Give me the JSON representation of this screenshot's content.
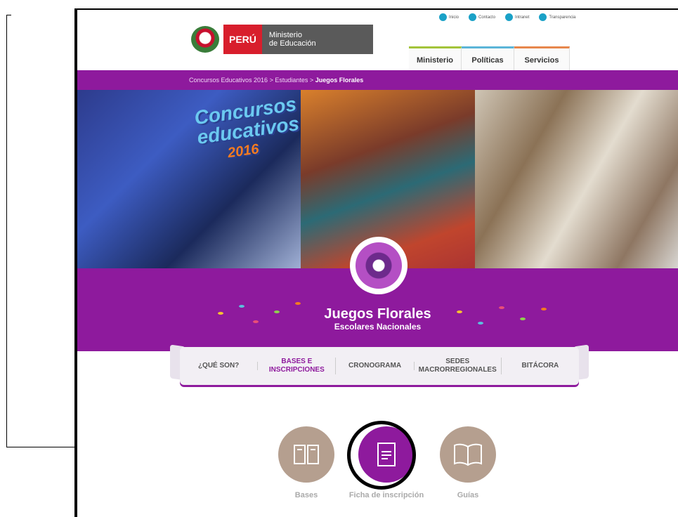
{
  "header": {
    "logo_country": "PERÚ",
    "logo_ministry_line1": "Ministerio",
    "logo_ministry_line2": "de Educación",
    "top_links": [
      "Inicio",
      "Contacto",
      "Intranet",
      "Transparencia"
    ],
    "main_nav": [
      "Ministerio",
      "Políticas",
      "Servicios"
    ]
  },
  "breadcrumb": {
    "part1": "Concursos Educativos 2016",
    "sep": ">",
    "part2": "Estudiantes",
    "current": "Juegos Florales"
  },
  "hero": {
    "badge_line1": "Concursos",
    "badge_line2": "educativos",
    "badge_year": "2016"
  },
  "banner": {
    "title": "Juegos Florales",
    "subtitle": "Escolares Nacionales"
  },
  "ribbon_nav": [
    {
      "label": "¿QUÉ SON?"
    },
    {
      "label": "BASES E INSCRIPCIONES"
    },
    {
      "label": "CRONOGRAMA"
    },
    {
      "label": "SEDES MACRORREGIONALES"
    },
    {
      "label": "BITÁCORA"
    }
  ],
  "resources": [
    {
      "label": "Bases",
      "icon": "book-open-icon"
    },
    {
      "label": "Ficha de inscripción",
      "icon": "document-icon"
    },
    {
      "label": "Guías",
      "icon": "book-icon"
    }
  ],
  "colors": {
    "brand_purple": "#8e1a9d",
    "peru_red": "#d81e2c",
    "icon_tan": "#b59f8f"
  }
}
